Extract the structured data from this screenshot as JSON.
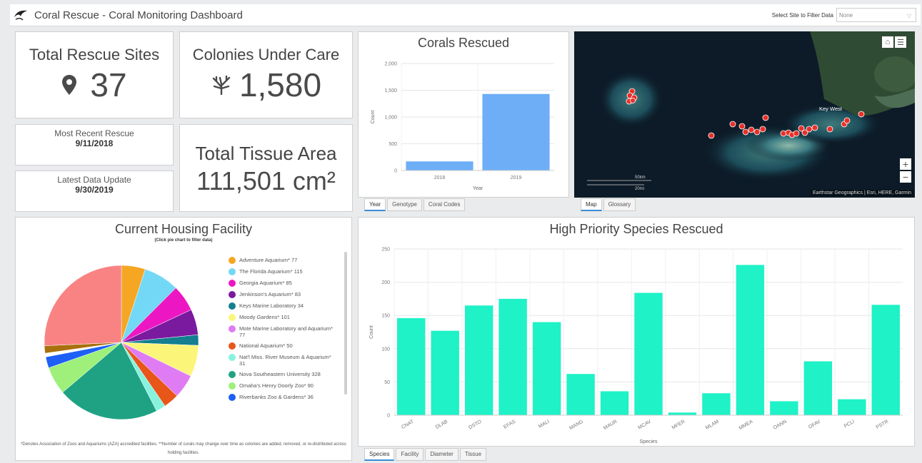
{
  "header": {
    "title": "Coral Rescue - Coral Monitoring Dashboard",
    "filter_label": "Select Site to Filter Data",
    "filter_value": "None"
  },
  "indicators": {
    "sites_title": "Total Rescue Sites",
    "sites_value": "37",
    "colonies_title": "Colonies Under Care",
    "colonies_value": "1,580",
    "recent_label": "Most Recent Rescue",
    "recent_value": "9/11/2018",
    "update_label": "Latest Data Update",
    "update_value": "9/30/2019",
    "tissue_title": "Total Tissue Area",
    "tissue_value": "111,501 cm²"
  },
  "corals_tabs": [
    "Year",
    "Genotype",
    "Coral Codes"
  ],
  "map": {
    "attribution": "Earthstar Geographics | Esri, HERE, Garmin",
    "place_label": "Key West",
    "scale_km": "50km",
    "scale_mi": "20mi",
    "zoom_in": "+",
    "zoom_out": "−"
  },
  "map_tabs": [
    "Map",
    "Glossary"
  ],
  "housing": {
    "title": "Current Housing Facility",
    "subtitle": "(Click pie chart to filter data)",
    "footnote": "*Denotes Association of Zoos and Aquariums (AZA) accredited facilities. **Number of corals may change over time as colonies are added, removed, or re-distributed across holding facilities."
  },
  "species_tabs": [
    "Species",
    "Facility",
    "Diameter",
    "Tissue"
  ],
  "colors": {
    "bar_blue": "#6eaef7",
    "bar_teal": "#1ef2c6",
    "map_dot": "#e8302a",
    "active_tab": "#3a8bd6"
  },
  "chart_data": [
    {
      "type": "bar",
      "title": "Corals Rescued",
      "xlabel": "Year",
      "ylabel": "Count",
      "categories": [
        "2018",
        "2019"
      ],
      "values": [
        170,
        1430
      ],
      "ylim": [
        0,
        2000
      ],
      "yticks": [
        "0",
        "500",
        "1,000",
        "1,500",
        "2,000"
      ],
      "grid": true
    },
    {
      "type": "bar",
      "title": "High Priority Species Rescued",
      "xlabel": "Species",
      "ylabel": "Count",
      "categories": [
        "CNAT",
        "DLAB",
        "DSTO",
        "EFAS",
        "MALI",
        "MANG",
        "MAUR",
        "MCAV",
        "MFER",
        "MLAM",
        "MMEA",
        "OANN",
        "OFAV",
        "PCLI",
        "PSTR"
      ],
      "values": [
        146,
        127,
        165,
        175,
        140,
        62,
        36,
        184,
        4,
        33,
        226,
        21,
        81,
        24,
        166
      ],
      "ylim": [
        0,
        250
      ],
      "yticks": [
        "0",
        "50",
        "100",
        "150",
        "200",
        "250"
      ],
      "grid": true
    },
    {
      "type": "pie",
      "title": "Current Housing Facility",
      "slices": [
        {
          "label": "Adventure Aquarium*",
          "value": 77,
          "color": "#f5a623"
        },
        {
          "label": "The Florida Aquarium*",
          "value": 115,
          "color": "#73d8f5"
        },
        {
          "label": "Georgia Aquarium*",
          "value": 85,
          "color": "#ec17c3"
        },
        {
          "label": "Jenkinson's Aquarium*",
          "value": 83,
          "color": "#7a1a9e"
        },
        {
          "label": "Keys Marine Laboratory",
          "value": 34,
          "color": "#137f8f"
        },
        {
          "label": "Moody Gardens*",
          "value": 101,
          "color": "#fbf67a"
        },
        {
          "label": "Mote Marine Laboratory and Aquarium*",
          "value": 77,
          "color": "#df7cf3"
        },
        {
          "label": "National Aquarium*",
          "value": 50,
          "color": "#e8561a"
        },
        {
          "label": "Nat'l Miss. River Museum & Aquarium*",
          "value": 31,
          "color": "#87f3df"
        },
        {
          "label": "Nova Southeastern University",
          "value": 328,
          "color": "#1fa283"
        },
        {
          "label": "Omaha's Henry Doorly Zoo*",
          "value": 90,
          "color": "#9ef07b"
        },
        {
          "label": "Riverbanks Zoo & Gardens*",
          "value": 36,
          "color": "#1e5ff5"
        },
        {
          "label": "",
          "value": 12,
          "color": "#ffffff"
        },
        {
          "label": "",
          "value": 24,
          "color": "#a9700e"
        },
        {
          "label": "",
          "value": 395,
          "color": "#f98383"
        }
      ]
    }
  ]
}
